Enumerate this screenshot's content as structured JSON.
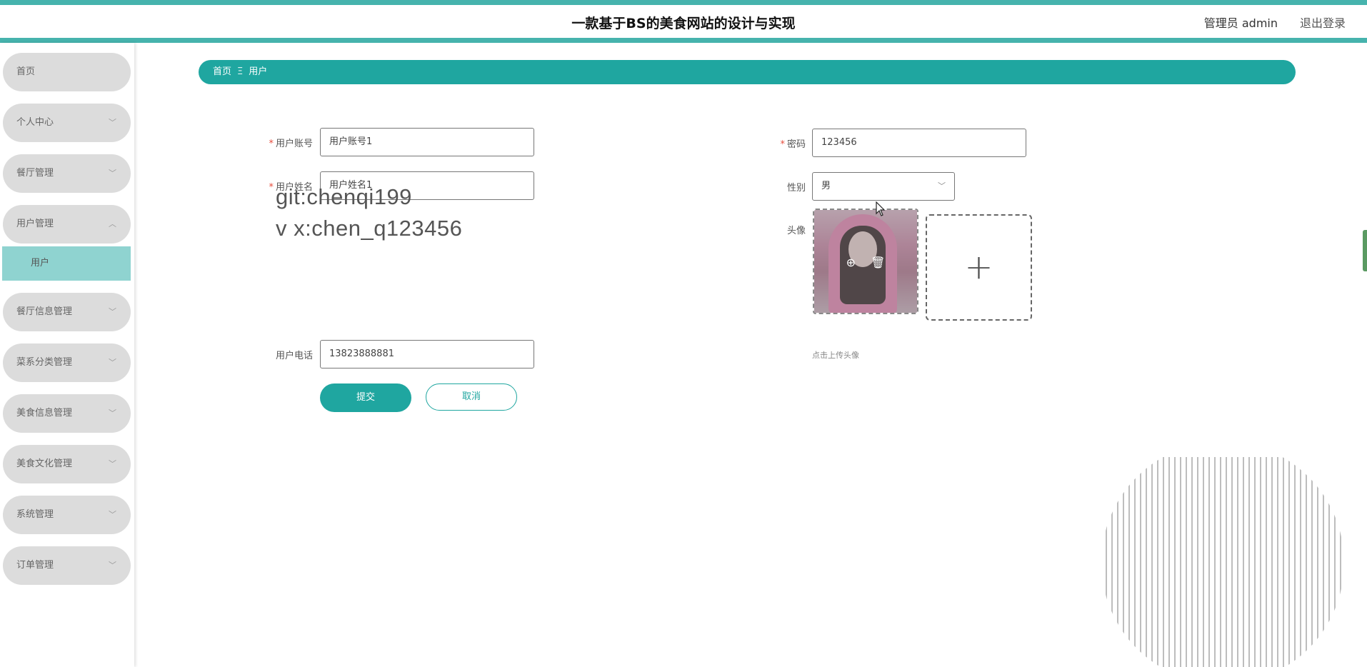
{
  "header": {
    "title": "一款基于BS的美食网站的设计与实现",
    "user": "管理员 admin",
    "logout": "退出登录"
  },
  "sidebar": {
    "items": [
      {
        "label": "首页",
        "chevron": ""
      },
      {
        "label": "个人中心",
        "chevron": "﹀"
      },
      {
        "label": "餐厅管理",
        "chevron": "﹀"
      },
      {
        "label": "用户管理",
        "chevron": "︿"
      },
      {
        "label": "餐厅信息管理",
        "chevron": "﹀"
      },
      {
        "label": "菜系分类管理",
        "chevron": "﹀"
      },
      {
        "label": "美食信息管理",
        "chevron": "﹀"
      },
      {
        "label": "美食文化管理",
        "chevron": "﹀"
      },
      {
        "label": "系统管理",
        "chevron": "﹀"
      },
      {
        "label": "订单管理",
        "chevron": "﹀"
      }
    ],
    "active_sub": "用户"
  },
  "breadcrumb": {
    "home": "首页",
    "separator": "Ξ",
    "current": "用户"
  },
  "form": {
    "account": {
      "label": "用户账号",
      "value": "用户账号1"
    },
    "password": {
      "label": "密码",
      "value": "123456"
    },
    "name": {
      "label": "用户姓名",
      "value": "用户姓名1"
    },
    "gender": {
      "label": "性别",
      "value": "男"
    },
    "avatar": {
      "label": "头像",
      "tip": "点击上传头像"
    },
    "phone": {
      "label": "用户电话",
      "value": "13823888881"
    },
    "required_mark": "*",
    "submit": "提交",
    "cancel": "取消"
  },
  "watermark": {
    "line1": "git:chenqi199",
    "line2": "v x:chen_q123456"
  },
  "icons": {
    "zoom": "⊕",
    "trash": "🗑",
    "plus": "+",
    "select_arrow": "﹀"
  },
  "colors": {
    "accent": "#1fa6a0",
    "header_border": "#46b3ad",
    "menu_bg": "#dcdcdc",
    "submenu_active": "#8fd3d0",
    "required": "#e74c3c"
  }
}
